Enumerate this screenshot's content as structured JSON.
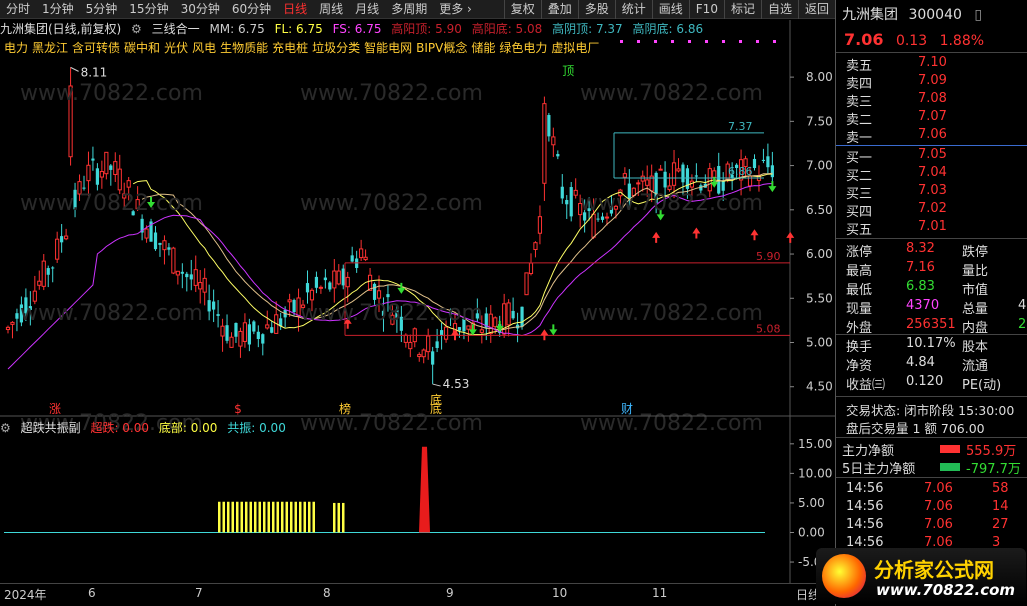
{
  "toolbar": {
    "items": [
      "分时",
      "1分钟",
      "5分钟",
      "15分钟",
      "30分钟",
      "60分钟",
      "日线",
      "周线",
      "月线",
      "多周期",
      "更多 ›"
    ],
    "active_index": 6,
    "right_items": [
      "复权",
      "叠加",
      "多股",
      "统计",
      "画线",
      "F10",
      "标记",
      "自选",
      "返回"
    ]
  },
  "info": {
    "title": "九洲集团(日线,前复权)",
    "indicator_name": "三线合一",
    "mm": "MM: 6.75",
    "fl": "FL: 6.75",
    "fs": "FS: 6.75",
    "gyd": "高阳顶: 5.90",
    "gyb": "高阳底: 5.08",
    "gyind": "高阴顶: 7.37",
    "gyinb": "高阴底: 6.86"
  },
  "concepts": [
    "电力",
    "黑龙江",
    "含可转债",
    "碳中和",
    "光伏",
    "风电",
    "生物质能",
    "充电桩",
    "垃圾分类",
    "智能电网",
    "BIPV概念",
    "储能",
    "绿色电力",
    "虚拟电厂"
  ],
  "indicator": {
    "name": "超跌共振副",
    "cd": "超跌: 0.00",
    "db": "底部: 0.00",
    "gz": "共振: 0.00"
  },
  "chart_data": {
    "type": "candlestick",
    "main_axis": {
      "ylim": [
        4.35,
        8.25
      ],
      "ticks": [
        "8.00",
        "7.50",
        "7.00",
        "6.50",
        "6.00",
        "5.50",
        "5.00",
        "4.50"
      ]
    },
    "sub_axis": {
      "ylim": [
        -5.5,
        17
      ],
      "ticks": [
        "15.00",
        "10.00",
        "5.00",
        "0.00",
        "-5.00"
      ]
    },
    "labels": {
      "high": "8.11",
      "low": "4.53",
      "top_mark": "顶",
      "bottom_mark": "底"
    },
    "levels": [
      {
        "value": 7.37,
        "label": "7.37",
        "color": "#3fb8c0"
      },
      {
        "value": 6.86,
        "label": "6.86",
        "color": "#3fb8c0"
      },
      {
        "value": 5.9,
        "label": "5.90",
        "color": "#c8202c"
      },
      {
        "value": 5.08,
        "label": "5.08",
        "color": "#c8202c"
      }
    ],
    "events": [
      "涨",
      "$",
      "榜",
      "底",
      "财"
    ],
    "x_labels": [
      "2024年",
      "6",
      "7",
      "8",
      "9",
      "10",
      "11",
      "日线"
    ],
    "colors": {
      "up": "#ff3232",
      "down": "#3fd8d8",
      "ma1": "#ffff66",
      "ma2": "#e0c08a",
      "ma3": "#cc33ff",
      "buy": "#33dd33",
      "sell": "#ff3333"
    }
  },
  "quote": {
    "name": "九洲集团",
    "code": "300040",
    "price": "7.06",
    "change": "0.13",
    "pct": "1.88%",
    "asks": [
      [
        "卖五",
        "7.10"
      ],
      [
        "卖四",
        "7.09"
      ],
      [
        "卖三",
        "7.08"
      ],
      [
        "卖二",
        "7.07"
      ],
      [
        "卖一",
        "7.06"
      ]
    ],
    "bids": [
      [
        "买一",
        "7.05"
      ],
      [
        "买二",
        "7.04"
      ],
      [
        "买三",
        "7.03"
      ],
      [
        "买四",
        "7.02"
      ],
      [
        "买五",
        "7.01"
      ]
    ],
    "stats": [
      [
        "涨停",
        "8.32",
        "跌停",
        ""
      ],
      [
        "最高",
        "7.16",
        "量比",
        ""
      ],
      [
        "最低",
        "6.83",
        "市值",
        ""
      ],
      [
        "现量",
        "4370",
        "总量",
        "4"
      ],
      [
        "外盘",
        "256351",
        "内盘",
        "2"
      ],
      [
        "换手",
        "10.17%",
        "股本",
        ""
      ],
      [
        "净资",
        "4.84",
        "流通",
        ""
      ],
      [
        "收益㈢",
        "0.120",
        "PE(动)",
        ""
      ]
    ],
    "state": "交易状态: 闭市阶段 15:30:00",
    "after": "盘后交易量 1 额 706.00",
    "flow": [
      [
        "主力净额",
        "555.9万"
      ],
      [
        "5日主力净额",
        "-797.7万"
      ]
    ],
    "ticks": [
      [
        "14:56",
        "7.06",
        "58"
      ],
      [
        "14:56",
        "7.06",
        "14"
      ],
      [
        "14:56",
        "7.06",
        "27"
      ],
      [
        "14:56",
        "7.06",
        "3"
      ]
    ]
  },
  "watermark": {
    "cn": "分析家公式网",
    "url": "www.70822.com"
  }
}
